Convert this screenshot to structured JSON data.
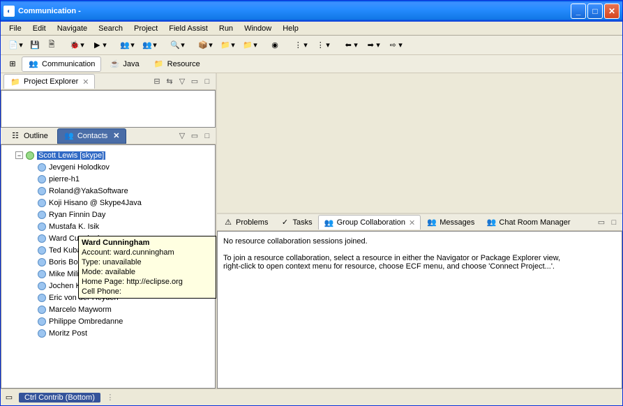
{
  "titlebar": {
    "title": "Communication -"
  },
  "menu": [
    "File",
    "Edit",
    "Navigate",
    "Search",
    "Project",
    "Field Assist",
    "Run",
    "Window",
    "Help"
  ],
  "perspectives": {
    "active": "Communication",
    "others": [
      "Java",
      "Resource"
    ]
  },
  "left": {
    "project_explorer": {
      "label": "Project Explorer",
      "close_x": "✕"
    },
    "outline": {
      "label": "Outline"
    },
    "contacts": {
      "label": "Contacts",
      "root": "Scott Lewis [skype]",
      "items": [
        "Jevgeni Holodkov",
        "pierre-h1",
        "Roland@YakaSoftware",
        "Koji Hisano @ Skype4Java",
        "Ryan Finnin Day",
        "Mustafa K. Isik",
        "Ward Cunningham",
        "Ted Kubaska",
        "Boris Bokowski",
        "Mike Milinkovich",
        "Jochen Krause",
        "Eric von der Heyden",
        "Marcelo Mayworm",
        "Philippe Ombredanne",
        "Moritz Post"
      ],
      "tooltip": {
        "name": "Ward Cunningham",
        "account": "Account: ward.cunningham",
        "type": "Type: unavailable",
        "mode": "Mode: available",
        "homepage": "Home Page: http://eclipse.org",
        "cell": "Cell Phone:"
      }
    }
  },
  "bottom_tabs": {
    "problems": "Problems",
    "tasks": "Tasks",
    "group": "Group Collaboration",
    "messages": "Messages",
    "chatroom": "Chat Room Manager",
    "content_line1": "No resource collaboration sessions joined.",
    "content_line2": "To join a resource collaboration, select a resource in either the Navigator or Package Explorer view,",
    "content_line3": "right-click to open context menu for resource, choose ECF menu, and choose 'Connect Project...'."
  },
  "status": {
    "pill": "Ctrl Contrib (Bottom)"
  }
}
